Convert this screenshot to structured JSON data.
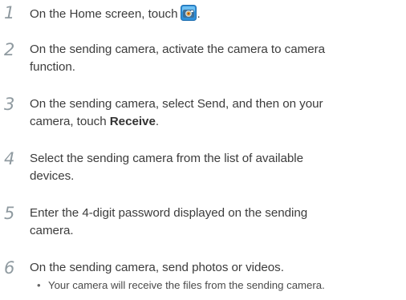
{
  "steps": [
    {
      "number": "1",
      "text_before": "On the Home screen, touch",
      "icon": "camera-app-icon",
      "text_after": "."
    },
    {
      "number": "2",
      "line1": "On the sending camera, activate the camera to camera",
      "line2": "function."
    },
    {
      "number": "3",
      "line1": "On the sending camera, select Send, and then on your",
      "line2_before": "camera, touch ",
      "line2_bold": "Receive",
      "line2_after": "."
    },
    {
      "number": "4",
      "line1": "Select the sending camera from the list of available",
      "line2": "devices."
    },
    {
      "number": "5",
      "line1": "Enter the 4-digit password displayed on the sending",
      "line2": "camera."
    },
    {
      "number": "6",
      "line1": "On the sending camera, send photos or videos.",
      "bullet": "•",
      "subnote": "Your camera will receive the files from the sending camera."
    }
  ],
  "colors": {
    "step_number": "#8f9aa0",
    "body_text": "#3c3c3c",
    "icon_blue": "#2f8fd8"
  }
}
